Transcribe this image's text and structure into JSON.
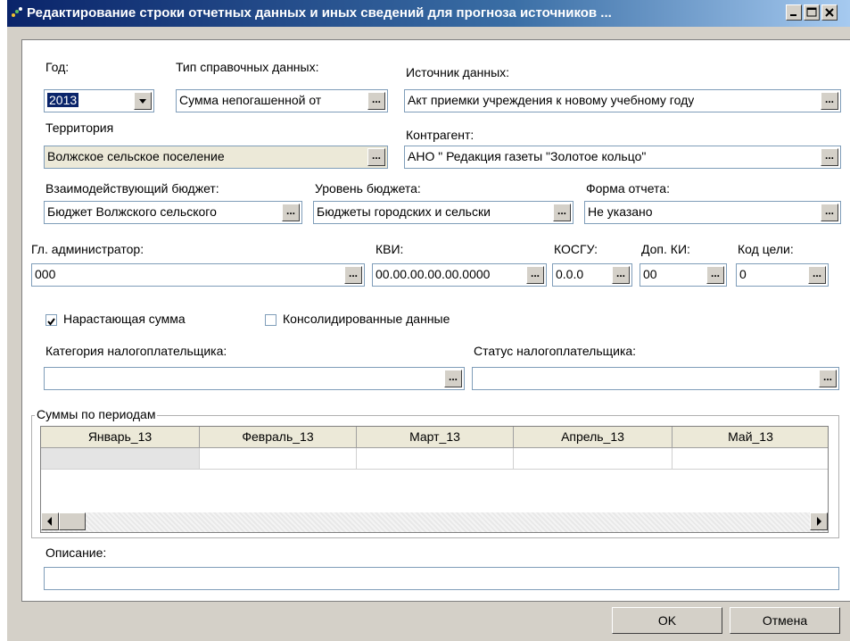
{
  "window": {
    "title": "Редактирование строки отчетных данных и иных сведений для прогноза источников ..."
  },
  "fields": {
    "year": {
      "label": "Год:",
      "value": "2013"
    },
    "ref_type": {
      "label": "Тип справочных данных:",
      "value": "Сумма непогашенной от"
    },
    "source": {
      "label": "Источник данных:",
      "value": "Акт приемки учреждения к новому учебному году"
    },
    "territory": {
      "label": "Территория",
      "value": "Волжское сельское поселение"
    },
    "contractor": {
      "label": "Контрагент:",
      "value": "АНО \" Редакция газеты \"Золотое кольцо\""
    },
    "interact_budget": {
      "label": "Взаимодействующий бюджет:",
      "value": "Бюджет Волжского сельского"
    },
    "budget_level": {
      "label": "Уровень бюджета:",
      "value": "Бюджеты городских и сельски"
    },
    "report_form": {
      "label": "Форма отчета:",
      "value": "Не указано"
    },
    "chief_admin": {
      "label": "Гл. администратор:",
      "value": "000"
    },
    "kvi": {
      "label": "КВИ:",
      "value": "00.00.00.00.00.0000"
    },
    "kosgu": {
      "label": "КОСГУ:",
      "value": "0.0.0"
    },
    "dop_ki": {
      "label": "Доп. КИ:",
      "value": "00"
    },
    "goal_code": {
      "label": "Код цели:",
      "value": "0"
    },
    "taxpayer_category": {
      "label": "Категория налогоплательщика:",
      "value": ""
    },
    "taxpayer_status": {
      "label": "Статус налогоплательщика:",
      "value": ""
    },
    "description": {
      "label": "Описание:",
      "value": ""
    }
  },
  "checkboxes": {
    "cumulative": {
      "label": "Нарастающая сумма",
      "checked": true
    },
    "consolidated": {
      "label": "Консолидированные данные",
      "checked": false
    }
  },
  "periods": {
    "title": "Суммы по периодам",
    "columns": [
      "Январь_13",
      "Февраль_13",
      "Март_13",
      "Апрель_13",
      "Май_13"
    ]
  },
  "buttons": {
    "ellipsis": "...",
    "ok": "OK",
    "cancel": "Отмена"
  }
}
